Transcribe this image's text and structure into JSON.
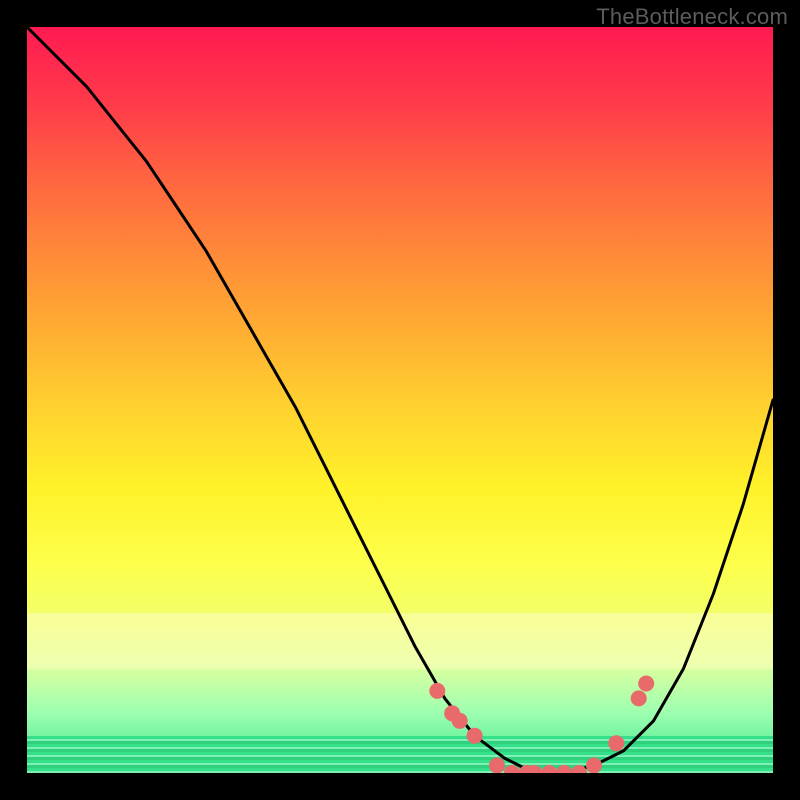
{
  "watermark": "TheBottleneck.com",
  "chart_data": {
    "type": "line",
    "title": "",
    "xlabel": "",
    "ylabel": "",
    "xlim": [
      0,
      100
    ],
    "ylim": [
      0,
      100
    ],
    "grid": false,
    "background": "gradient-red-yellow-green",
    "series": [
      {
        "name": "bottleneck-curve",
        "x": [
          0,
          4,
          8,
          12,
          16,
          20,
          24,
          28,
          32,
          36,
          40,
          44,
          48,
          52,
          56,
          60,
          64,
          68,
          72,
          76,
          80,
          84,
          88,
          92,
          96,
          100
        ],
        "y": [
          100,
          96,
          92,
          87,
          82,
          76,
          70,
          63,
          56,
          49,
          41,
          33,
          25,
          17,
          10,
          5,
          2,
          0,
          0,
          1,
          3,
          7,
          14,
          24,
          36,
          50
        ],
        "color": "#000000"
      }
    ],
    "markers": {
      "name": "highlighted-points",
      "color": "#e96a6a",
      "radius_px": 8,
      "points": [
        {
          "x": 55,
          "y": 11
        },
        {
          "x": 57,
          "y": 8
        },
        {
          "x": 58,
          "y": 7
        },
        {
          "x": 60,
          "y": 5
        },
        {
          "x": 63,
          "y": 1
        },
        {
          "x": 65,
          "y": 0
        },
        {
          "x": 67,
          "y": 0
        },
        {
          "x": 68,
          "y": 0
        },
        {
          "x": 70,
          "y": 0
        },
        {
          "x": 72,
          "y": 0
        },
        {
          "x": 74,
          "y": 0
        },
        {
          "x": 76,
          "y": 1
        },
        {
          "x": 79,
          "y": 4
        },
        {
          "x": 82,
          "y": 10
        },
        {
          "x": 83,
          "y": 12
        }
      ]
    }
  }
}
